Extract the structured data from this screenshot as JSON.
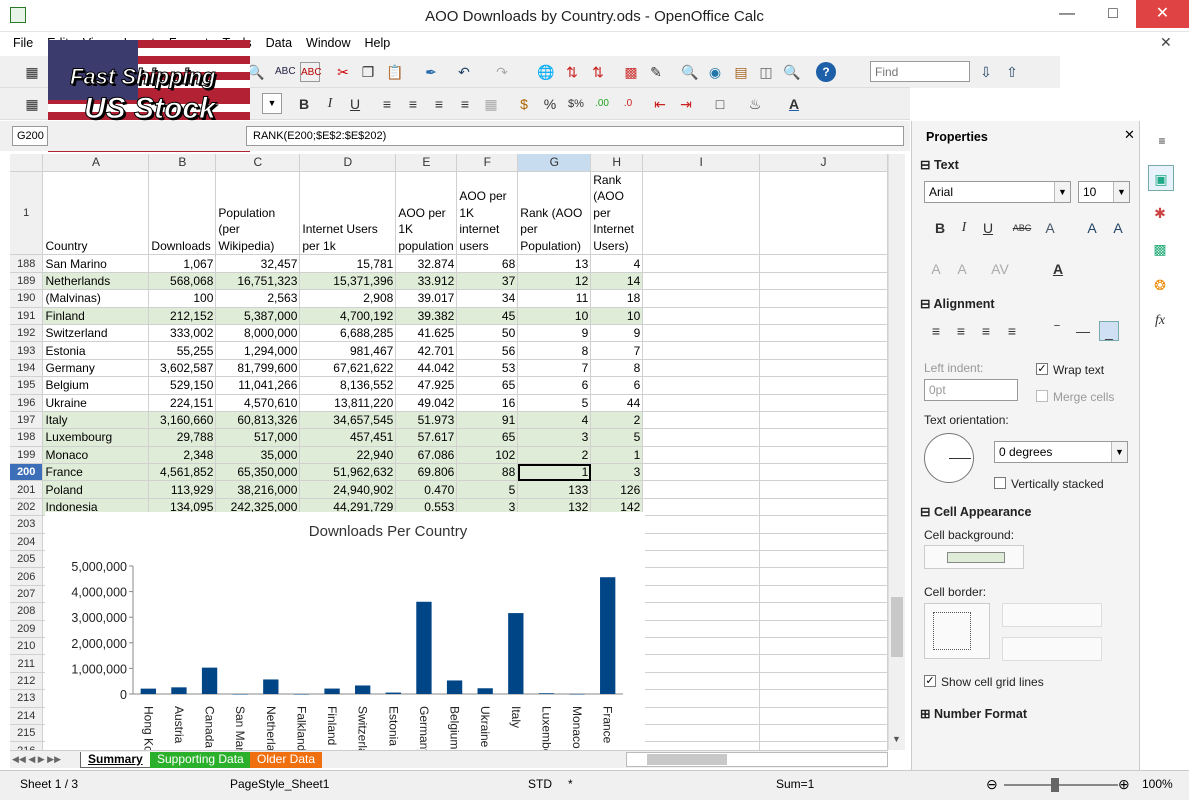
{
  "window": {
    "title": "AOO Downloads by Country.ods - OpenOffice Calc"
  },
  "menu": [
    "File",
    "Edit",
    "View",
    "Insert",
    "Format",
    "Tools",
    "Data",
    "Window",
    "Help"
  ],
  "find": {
    "placeholder": "Find"
  },
  "namebox": "G200",
  "formula": "RANK(E200;$E$2:$E$202)",
  "columns": [
    "A",
    "B",
    "C",
    "D",
    "E",
    "F",
    "G",
    "H",
    "I",
    "J"
  ],
  "header_row": {
    "num": "1",
    "cells": [
      "Country",
      "Downloads",
      "Population (per Wikipedia)",
      "Internet Users per 1k",
      "AOO per 1K population",
      "AOO per 1K internet users",
      "Rank (AOO per Population)",
      "Rank (AOO per Internet Users)"
    ]
  },
  "rows": [
    {
      "n": "188",
      "c": [
        "San Marino",
        "1,067",
        "32,457",
        "15,781",
        "32.874",
        "68",
        "13",
        "4"
      ],
      "hl": false
    },
    {
      "n": "189",
      "c": [
        "Netherlands",
        "568,068",
        "16,751,323",
        "15,371,396",
        "33.912",
        "37",
        "12",
        "14"
      ],
      "hl": true
    },
    {
      "n": "190",
      "c": [
        "(Malvinas)",
        "100",
        "2,563",
        "2,908",
        "39.017",
        "34",
        "11",
        "18"
      ],
      "hl": false
    },
    {
      "n": "191",
      "c": [
        "Finland",
        "212,152",
        "5,387,000",
        "4,700,192",
        "39.382",
        "45",
        "10",
        "10"
      ],
      "hl": true
    },
    {
      "n": "192",
      "c": [
        "Switzerland",
        "333,002",
        "8,000,000",
        "6,688,285",
        "41.625",
        "50",
        "9",
        "9"
      ],
      "hl": false
    },
    {
      "n": "193",
      "c": [
        "Estonia",
        "55,255",
        "1,294,000",
        "981,467",
        "42.701",
        "56",
        "8",
        "7"
      ],
      "hl": false
    },
    {
      "n": "194",
      "c": [
        "Germany",
        "3,602,587",
        "81,799,600",
        "67,621,622",
        "44.042",
        "53",
        "7",
        "8"
      ],
      "hl": false
    },
    {
      "n": "195",
      "c": [
        "Belgium",
        "529,150",
        "11,041,266",
        "8,136,552",
        "47.925",
        "65",
        "6",
        "6"
      ],
      "hl": false
    },
    {
      "n": "196",
      "c": [
        "Ukraine",
        "224,151",
        "4,570,610",
        "13,811,220",
        "49.042",
        "16",
        "5",
        "44"
      ],
      "hl": false
    },
    {
      "n": "197",
      "c": [
        "Italy",
        "3,160,660",
        "60,813,326",
        "34,657,545",
        "51.973",
        "91",
        "4",
        "2"
      ],
      "hl": true
    },
    {
      "n": "198",
      "c": [
        "Luxembourg",
        "29,788",
        "517,000",
        "457,451",
        "57.617",
        "65",
        "3",
        "5"
      ],
      "hl": true
    },
    {
      "n": "199",
      "c": [
        "Monaco",
        "2,348",
        "35,000",
        "22,940",
        "67.086",
        "102",
        "2",
        "1"
      ],
      "hl": true
    },
    {
      "n": "200",
      "c": [
        "France",
        "4,561,852",
        "65,350,000",
        "51,962,632",
        "69.806",
        "88",
        "1",
        "3"
      ],
      "hl": true
    },
    {
      "n": "201",
      "c": [
        "Poland",
        "113,929",
        "38,216,000",
        "24,940,902",
        "0.470",
        "5",
        "133",
        "126"
      ],
      "hl": true
    },
    {
      "n": "202",
      "c": [
        "Indonesia",
        "134,095",
        "242,325,000",
        "44,291,729",
        "0.553",
        "3",
        "132",
        "142"
      ],
      "hl": true
    }
  ],
  "empty_rows": [
    "203",
    "204",
    "205",
    "206",
    "207",
    "208",
    "209",
    "210",
    "211",
    "212",
    "213",
    "214",
    "215",
    "216"
  ],
  "chart_data": {
    "type": "bar",
    "title": "Downloads Per Country",
    "categories": [
      "Hong Ko",
      "Austria",
      "Canada",
      "San Mar",
      "Netherla",
      "Falkland",
      "Finland",
      "Switzerla",
      "Estonia",
      "Germany",
      "Belgium",
      "Ukraine",
      "Italy",
      "Luxembo",
      "Monaco",
      "France"
    ],
    "values": [
      210000,
      260000,
      1030000,
      1067,
      568068,
      100,
      212152,
      333002,
      55255,
      3602587,
      529150,
      224151,
      3160660,
      29788,
      2348,
      4561852
    ],
    "ylim": [
      0,
      5000000
    ],
    "yticks": [
      "5,000,000",
      "4,000,000",
      "3,000,000",
      "2,000,000",
      "1,000,000",
      "0"
    ],
    "color": "#004586"
  },
  "sheet_tabs": [
    "Summary",
    "Supporting Data",
    "Older Data"
  ],
  "status": {
    "sheet": "Sheet 1 / 3",
    "style": "PageStyle_Sheet1",
    "mode": "STD",
    "mod": "*",
    "sum": "Sum=1",
    "zoom": "100%"
  },
  "sidebar": {
    "title": "Properties",
    "text_section": "Text",
    "font": "Arial",
    "size": "10",
    "align_section": "Alignment",
    "left_indent": "Left indent:",
    "indent_val": "0pt",
    "wrap": "Wrap text",
    "merge": "Merge cells",
    "orientation": "Text orientation:",
    "degrees": "0 degrees",
    "stacked": "Vertically stacked",
    "cell_section": "Cell Appearance",
    "cell_bg": "Cell background:",
    "cell_border": "Cell border:",
    "gridlines": "Show cell grid lines",
    "number_section": "Number Format"
  },
  "promo": {
    "line1": "Fast Shipping",
    "line2": "US Stock"
  }
}
